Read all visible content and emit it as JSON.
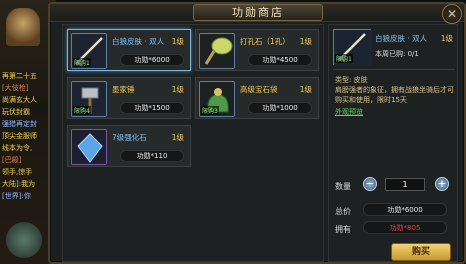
{
  "window": {
    "title": "功勋商店",
    "close_glyph": "✕"
  },
  "chat": [
    {
      "text": "再第二十五",
      "color": "yellow"
    },
    {
      "text": "[大伎枪]",
      "color": "red"
    },
    {
      "text": "尚满玄大人",
      "color": "yellow"
    },
    {
      "text": "玩伏封霸",
      "color": "yellow"
    },
    {
      "text": "强猎再定封",
      "color": "blue"
    },
    {
      "text": "顶尖金服师",
      "color": "yellow"
    },
    {
      "text": "线本为令,",
      "color": "yellow"
    },
    {
      "text": "[巴殿]",
      "color": "red"
    },
    {
      "text": "领手,惊手",
      "color": "yellow"
    },
    {
      "text": "大陆]:我为",
      "color": "yellow"
    },
    {
      "text": "[世界]:你",
      "color": "blue"
    }
  ],
  "items": [
    {
      "name": "白狼皮肤 · 双人",
      "level": "1级",
      "price": "功勋*6000",
      "tag": "限购1",
      "icon": "wolf-skin-icon",
      "selected": true,
      "name_color": "blue"
    },
    {
      "name": "打孔石（1孔）",
      "level": "1级",
      "price": "功勋*4500",
      "tag": "",
      "icon": "drill-stone-icon",
      "selected": false,
      "name_color": "yellow"
    },
    {
      "name": "墨家锤",
      "level": "1级",
      "price": "功勋*1500",
      "tag": "限购4",
      "icon": "mohist-hammer-icon",
      "selected": false,
      "name_color": "yellow"
    },
    {
      "name": "高级宝石袋",
      "level": "1级",
      "price": "功勋*1000",
      "tag": "限购3",
      "icon": "gem-bag-icon",
      "selected": false,
      "name_color": "yellow"
    },
    {
      "name": "7级强化石",
      "level": "1级",
      "price": "功勋*110",
      "tag": "",
      "icon": "enhance-stone-icon",
      "selected": false,
      "name_color": "blue"
    }
  ],
  "detail": {
    "name": "白狼皮肤 · 双人",
    "level": "1级",
    "icon_tag": "限购1",
    "bought": "本周已购: 0/1",
    "type": "类型: 皮肤",
    "desc": "肩膀强者的象征，拥有战狼坐骑后才可购买和使用，限时15天",
    "link": "外观预览",
    "qty_label": "数量",
    "qty_value": "1",
    "total_label": "总价",
    "total_value": "功勋*6000",
    "own_label": "拥有",
    "own_value": "功勋*805",
    "buy_label": "购买"
  },
  "colors": {
    "accent_blue": "#7ec0f0",
    "accent_yellow": "#f0cc5a",
    "own_red": "#e04040",
    "link_green": "#5fd65f"
  }
}
